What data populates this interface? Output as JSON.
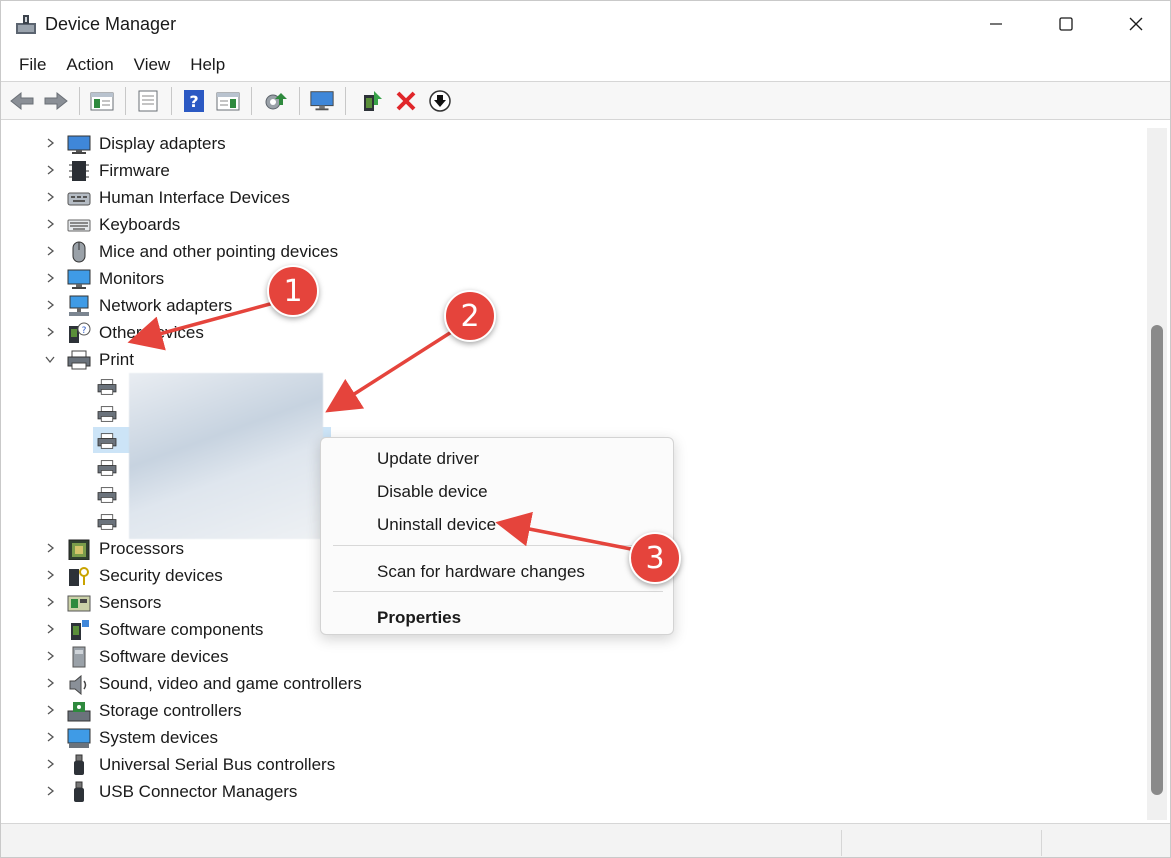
{
  "window": {
    "title": "Device Manager",
    "minimize_icon": "minimize-icon",
    "maximize_icon": "maximize-icon",
    "close_icon": "close-icon"
  },
  "menu": [
    "File",
    "Action",
    "View",
    "Help"
  ],
  "toolbar": {
    "icons": [
      "back-icon",
      "forward-icon",
      "console-tree-icon",
      "properties-icon",
      "help-icon",
      "action-pane-icon",
      "scan-hardware-icon",
      "display-icon",
      "update-driver-icon",
      "uninstall-icon",
      "download-icon"
    ]
  },
  "tree": {
    "categories_top": [
      {
        "label": "Display adapters",
        "icon": "display-adapter-icon"
      },
      {
        "label": "Firmware",
        "icon": "firmware-icon"
      },
      {
        "label": "Human Interface Devices",
        "icon": "hid-icon"
      },
      {
        "label": "Keyboards",
        "icon": "keyboard-icon"
      },
      {
        "label": "Mice and other pointing devices",
        "icon": "mouse-icon"
      },
      {
        "label": "Monitors",
        "icon": "monitor-icon"
      },
      {
        "label": "Network adapters",
        "icon": "network-icon"
      },
      {
        "label": "Other devices",
        "icon": "other-devices-icon"
      }
    ],
    "expanded": {
      "label": "Print",
      "icon": "printer-icon",
      "children_count": 6
    },
    "categories_bottom": [
      {
        "label": "Processors",
        "icon": "processor-icon"
      },
      {
        "label": "Security devices",
        "icon": "security-icon"
      },
      {
        "label": "Sensors",
        "icon": "sensor-icon"
      },
      {
        "label": "Software components",
        "icon": "software-component-icon"
      },
      {
        "label": "Software devices",
        "icon": "software-device-icon"
      },
      {
        "label": "Sound, video and game controllers",
        "icon": "sound-icon"
      },
      {
        "label": "Storage controllers",
        "icon": "storage-icon"
      },
      {
        "label": "System devices",
        "icon": "system-icon"
      },
      {
        "label": "Universal Serial Bus controllers",
        "icon": "usb-icon"
      },
      {
        "label": "USB Connector Managers",
        "icon": "usb-connector-icon"
      }
    ]
  },
  "context_menu": {
    "update_driver": "Update driver",
    "disable_device": "Disable device",
    "uninstall_device": "Uninstall device",
    "scan_hardware": "Scan for hardware changes",
    "properties": "Properties"
  },
  "annotations": {
    "badge1": "1",
    "badge2": "2",
    "badge3": "3",
    "color": "#e5443c"
  },
  "colors": {
    "selection": "#cce4f7",
    "close_x": "#e0262a"
  }
}
